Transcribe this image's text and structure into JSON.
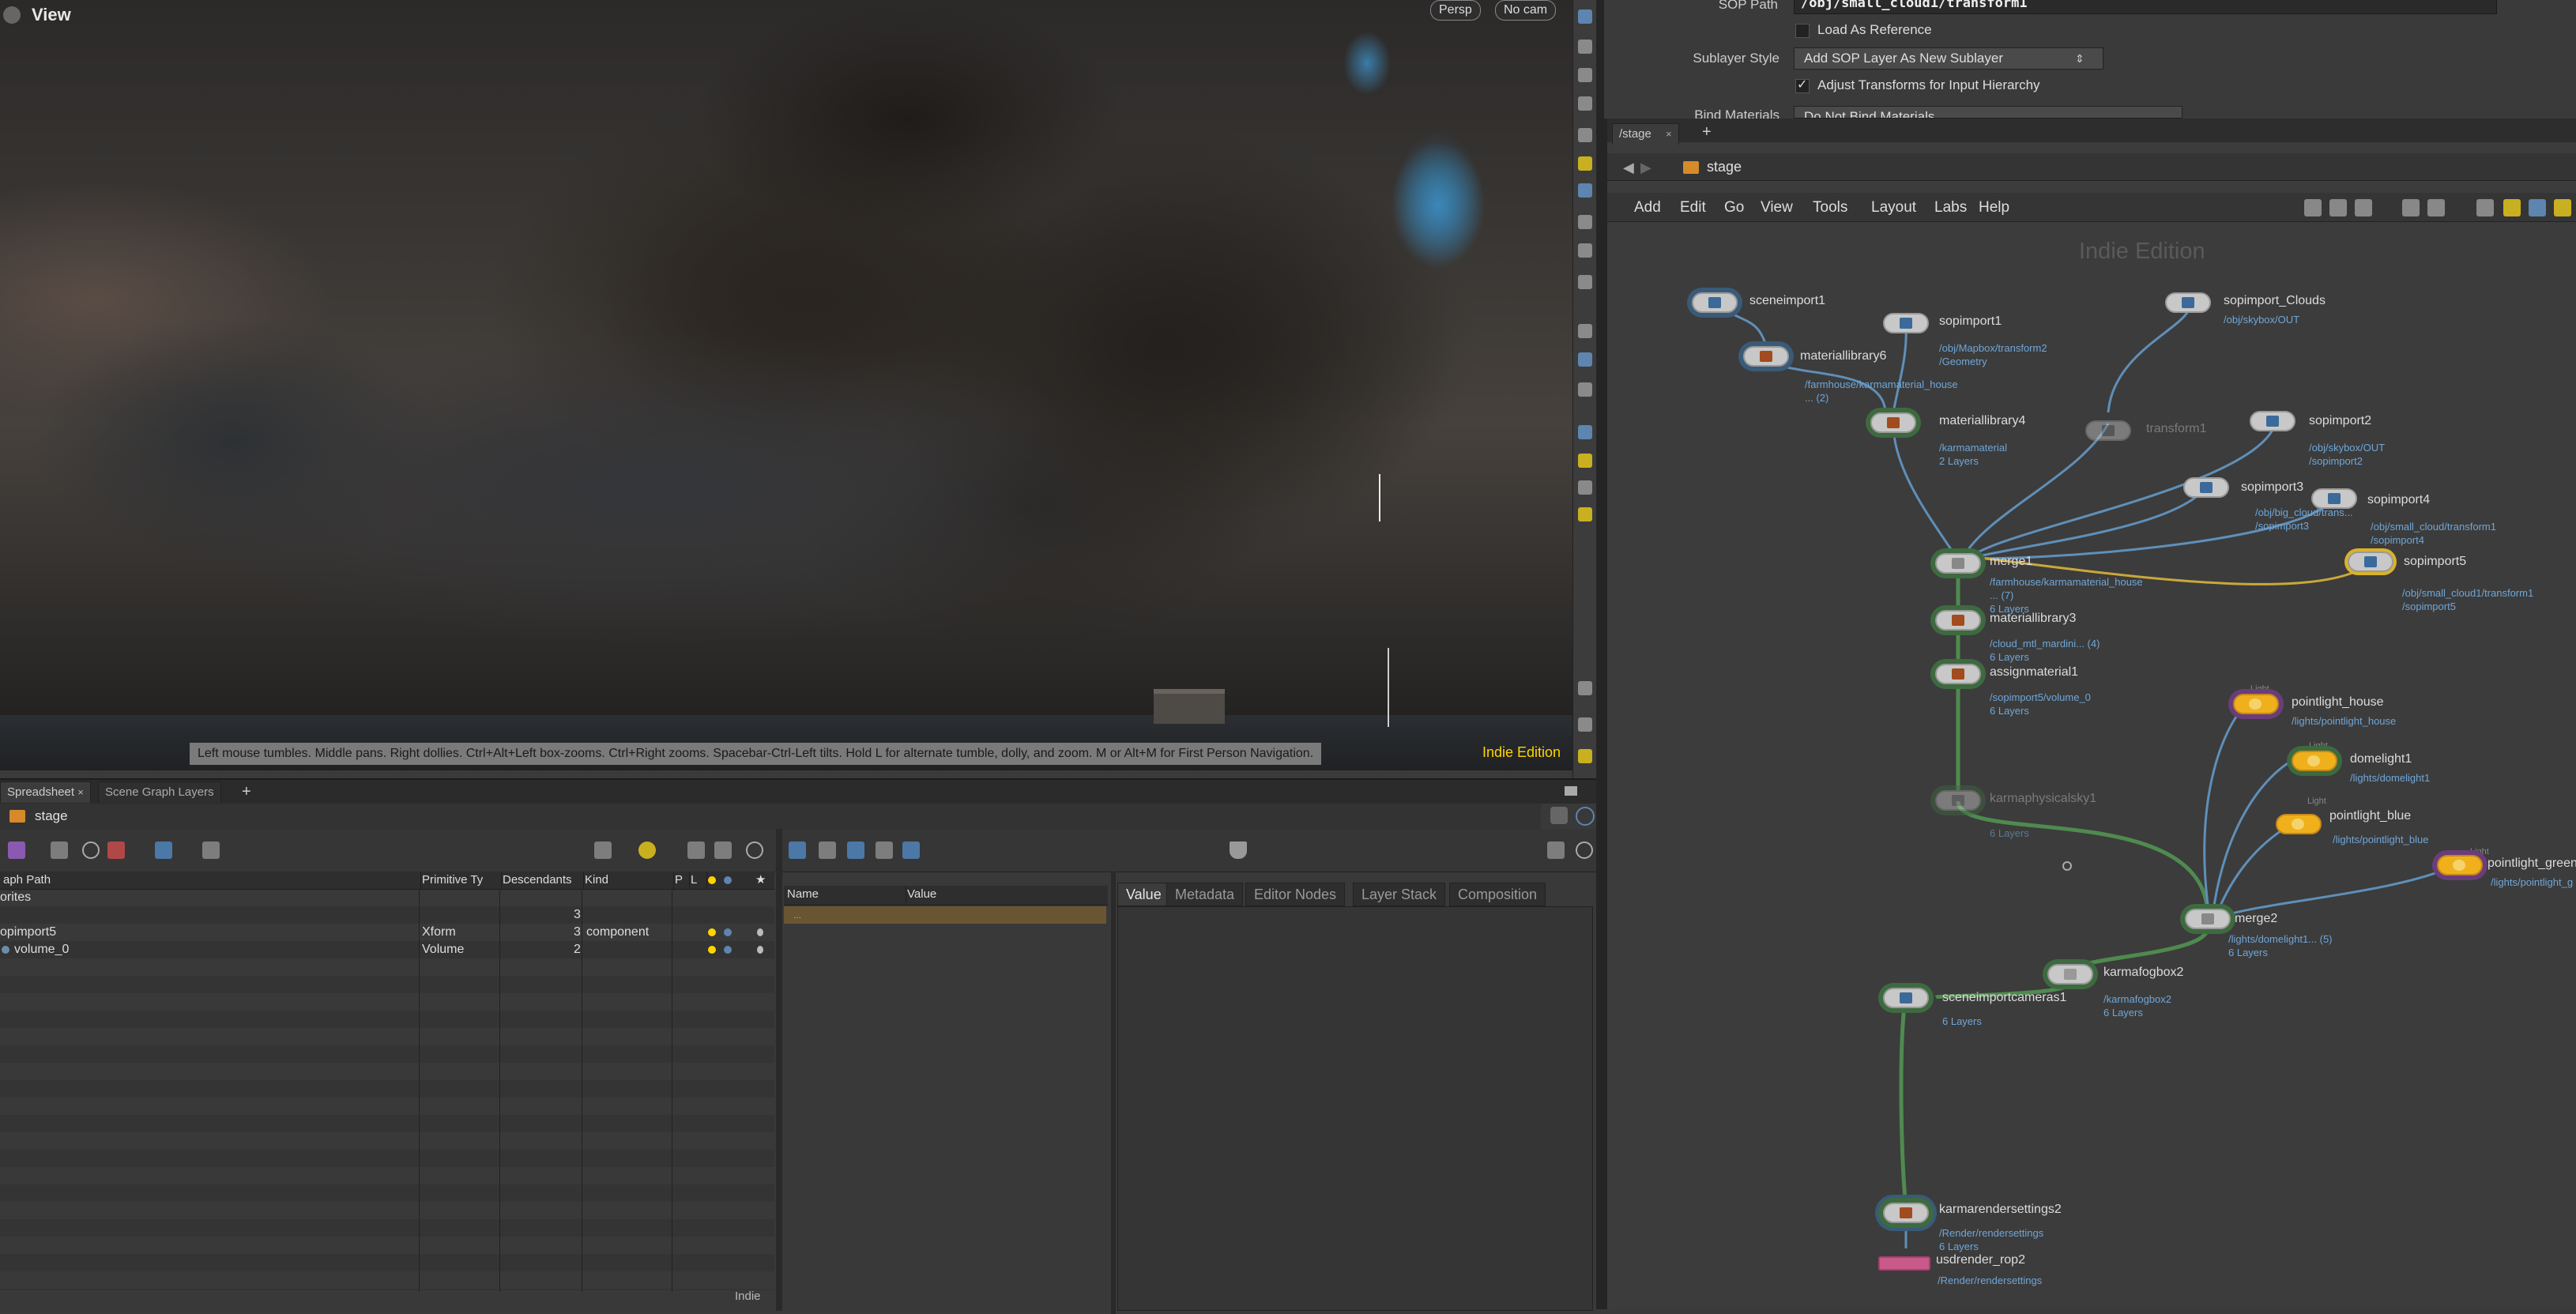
{
  "viewport": {
    "title": "View",
    "camera_mode": "Persp",
    "camera": "No cam",
    "hint": "Left mouse tumbles. Middle pans. Right dollies. Ctrl+Alt+Left box-zooms. Ctrl+Right zooms. Spacebar-Ctrl-Left tilts. Hold L for alternate tumble, dolly, and zoom. M or Alt+M for First Person Navigation.",
    "edition": "Indie Edition"
  },
  "spreadsheet": {
    "tabs": [
      "Spreadsheet",
      "Scene Graph Layers"
    ],
    "path": "stage",
    "columns": [
      "aph Path",
      "Primitive Ty",
      "Descendants",
      "Kind",
      "P",
      "L"
    ],
    "rows": [
      {
        "path": "orites",
        "type": "",
        "descendants": "",
        "kind": ""
      },
      {
        "path": "",
        "type": "",
        "descendants": "3",
        "kind": ""
      },
      {
        "path": "opimport5",
        "type": "Xform",
        "descendants": "3",
        "kind": "component"
      },
      {
        "path": "volume_0",
        "type": "Volume",
        "descendants": "2",
        "kind": ""
      }
    ],
    "attr_columns": [
      "Name",
      "Value"
    ],
    "attr_placeholder": "...",
    "right_tabs": [
      "Value",
      "Metadata",
      "Editor Nodes",
      "Layer Stack",
      "Composition"
    ],
    "edition": "Indie"
  },
  "params": {
    "sop_path_label": "SOP Path",
    "sop_path": "/obj/small_cloud1/transform1",
    "load_as_reference": "Load As Reference",
    "sublayer_style_label": "Sublayer Style",
    "sublayer_style": "Add SOP Layer As New Sublayer",
    "adjust_transforms": "Adjust Transforms for Input Hierarchy",
    "bind_materials_label": "Bind Materials",
    "bind_materials": "Do Not Bind Materials"
  },
  "network": {
    "tab": "/stage",
    "path": "stage",
    "menu": [
      "Add",
      "Edit",
      "Go",
      "View",
      "Tools",
      "Layout",
      "Labs",
      "Help"
    ],
    "watermark": "Indie Edition",
    "nodes": [
      {
        "name": "sceneimport1",
        "sub": ""
      },
      {
        "name": "sopimport1",
        "sub": "/obj/Mapbox/transform2\n/Geometry"
      },
      {
        "name": "sopimport_Clouds",
        "sub": "/obj/skybox/OUT"
      },
      {
        "name": "materiallibrary6",
        "sub": "/farmhouse/karmamaterial_house\n... (2)"
      },
      {
        "name": "materiallibrary4",
        "sub": "/karmamaterial\n2 Layers"
      },
      {
        "name": "transform1",
        "sub": ""
      },
      {
        "name": "sopimport2",
        "sub": "/obj/skybox/OUT\n/sopimport2"
      },
      {
        "name": "sopimport3",
        "sub": "/obj/big_cloud/trans...\n/sopimport3"
      },
      {
        "name": "sopimport4",
        "sub": "/obj/small_cloud/transform1\n/sopimport4"
      },
      {
        "name": "sopimport5",
        "sub": "/obj/small_cloud1/transform1\n/sopimport5"
      },
      {
        "name": "merge1",
        "sub": "/farmhouse/karmamaterial_house\n... (7)\n6 Layers"
      },
      {
        "name": "materiallibrary3",
        "sub": "/cloud_mtl_mardini... (4)\n6 Layers"
      },
      {
        "name": "assignmaterial1",
        "sub": "/sopimport5/volume_0\n6 Layers"
      },
      {
        "name": "karmaphysicalsky1",
        "sub": "6 Layers"
      },
      {
        "name": "pointlight_house",
        "sub": "/lights/pointlight_house"
      },
      {
        "name": "domelight1",
        "sub": "/lights/domelight1"
      },
      {
        "name": "pointlight_blue",
        "sub": "/lights/pointlight_blue"
      },
      {
        "name": "pointlight_green",
        "sub": "/lights/pointlight_g"
      },
      {
        "name": "merge2",
        "sub": "/lights/domelight1... (5)\n6 Layers"
      },
      {
        "name": "karmafogbox2",
        "sub": "/karmafogbox2\n6 Layers"
      },
      {
        "name": "sceneimportcameras1",
        "sub": "6 Layers"
      },
      {
        "name": "karmarendersettings2",
        "sub": "/Render/rendersettings\n6 Layers"
      },
      {
        "name": "usdrender_rop2",
        "sub": "/Render/rendersettings"
      }
    ],
    "light_label": "Light"
  },
  "colors": {
    "accent_yellow": "#ffd400",
    "wire_green": "#4f8a4f",
    "wire_blue": "#5f8fb8",
    "wire_yellow": "#c9a83a"
  }
}
